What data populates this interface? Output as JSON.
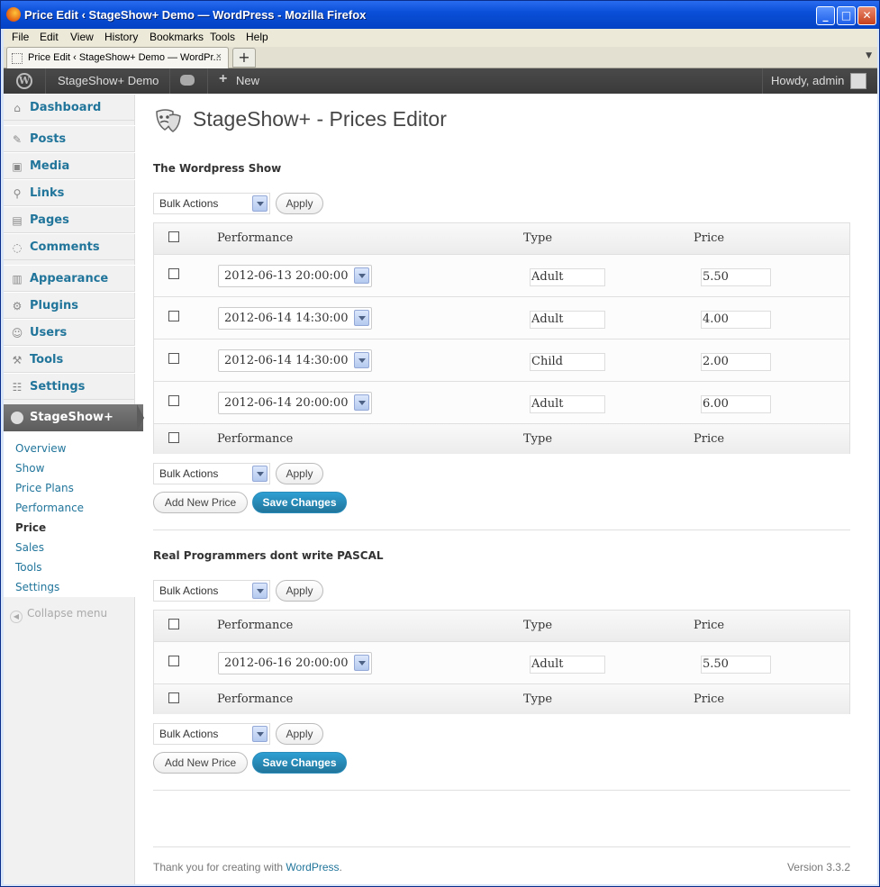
{
  "window": {
    "title": "Price Edit ‹ StageShow+ Demo — WordPress - Mozilla Firefox"
  },
  "menubar": [
    "File",
    "Edit",
    "View",
    "History",
    "Bookmarks",
    "Tools",
    "Help"
  ],
  "tab": {
    "label": "Price Edit ‹ StageShow+ Demo — WordPr...",
    "close": "×",
    "new": "+"
  },
  "adminbar": {
    "site": "StageShow+ Demo",
    "new": "New",
    "howdy": "Howdy, admin"
  },
  "sidebar": {
    "items": [
      {
        "label": "Dashboard",
        "icon": "dashboard-icon",
        "glyph": "⌂"
      },
      {
        "label": "Posts",
        "icon": "posts-icon",
        "glyph": "✎"
      },
      {
        "label": "Media",
        "icon": "media-icon",
        "glyph": "▣"
      },
      {
        "label": "Links",
        "icon": "links-icon",
        "glyph": "⚲"
      },
      {
        "label": "Pages",
        "icon": "pages-icon",
        "glyph": "▤"
      },
      {
        "label": "Comments",
        "icon": "comments-icon",
        "glyph": "◌"
      },
      {
        "label": "Appearance",
        "icon": "appearance-icon",
        "glyph": "▥"
      },
      {
        "label": "Plugins",
        "icon": "plugins-icon",
        "glyph": "⚙"
      },
      {
        "label": "Users",
        "icon": "users-icon",
        "glyph": "☺"
      },
      {
        "label": "Tools",
        "icon": "tools-icon",
        "glyph": "⚒"
      },
      {
        "label": "Settings",
        "icon": "settings-icon",
        "glyph": "☷"
      }
    ],
    "active": "StageShow+",
    "submenu": [
      "Overview",
      "Show",
      "Price Plans",
      "Performance",
      "Price",
      "Sales",
      "Tools",
      "Settings"
    ],
    "current_submenu": "Price",
    "collapse": "Collapse menu"
  },
  "page": {
    "title": "StageShow+ - Prices Editor"
  },
  "common": {
    "bulk": "Bulk Actions",
    "apply": "Apply",
    "add_new": "Add New Price",
    "save": "Save Changes",
    "col_performance": "Performance",
    "col_type": "Type",
    "col_price": "Price"
  },
  "shows": [
    {
      "name": "The Wordpress Show",
      "rows": [
        {
          "performance": "2012-06-13 20:00:00",
          "type": "Adult",
          "price": "5.50"
        },
        {
          "performance": "2012-06-14 14:30:00",
          "type": "Adult",
          "price": "4.00"
        },
        {
          "performance": "2012-06-14 14:30:00",
          "type": "Child",
          "price": "2.00"
        },
        {
          "performance": "2012-06-14 20:00:00",
          "type": "Adult",
          "price": "6.00"
        }
      ]
    },
    {
      "name": "Real Programmers dont write PASCAL",
      "rows": [
        {
          "performance": "2012-06-16 20:00:00",
          "type": "Adult",
          "price": "5.50"
        }
      ]
    }
  ],
  "footer": {
    "thanks": "Thank you for creating with ",
    "link": "WordPress",
    "end": ".",
    "version": "Version 3.3.2"
  },
  "colors": {
    "link": "#21759b",
    "primary_button": "#21759b",
    "admin_bar": "#464646"
  }
}
